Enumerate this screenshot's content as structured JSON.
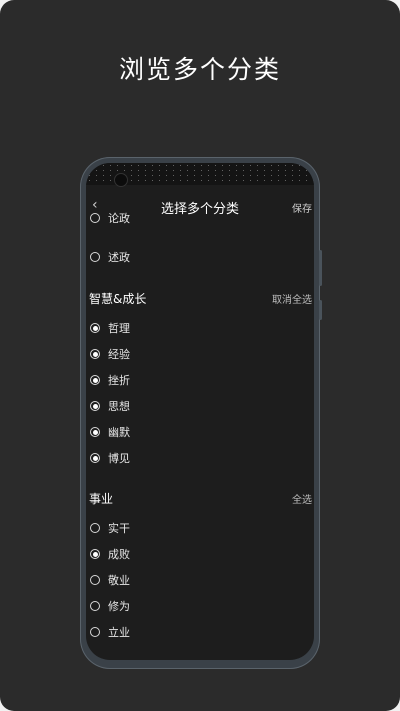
{
  "headline": "浏览多个分类",
  "app": {
    "title": "选择多个分类",
    "back_icon": "chevron-left-icon",
    "save_label": "保存"
  },
  "partial_top_item": "论政",
  "items_top": [
    {
      "label": "述政",
      "selected": false
    }
  ],
  "sections": [
    {
      "title": "智慧&成长",
      "action": "取消全选",
      "items": [
        {
          "label": "哲理",
          "selected": true
        },
        {
          "label": "经验",
          "selected": true
        },
        {
          "label": "挫折",
          "selected": true
        },
        {
          "label": "思想",
          "selected": true
        },
        {
          "label": "幽默",
          "selected": true
        },
        {
          "label": "博见",
          "selected": true
        }
      ]
    },
    {
      "title": "事业",
      "action": "全选",
      "items": [
        {
          "label": "实干",
          "selected": false
        },
        {
          "label": "成败",
          "selected": true
        },
        {
          "label": "敬业",
          "selected": false
        },
        {
          "label": "修为",
          "selected": false
        },
        {
          "label": "立业",
          "selected": false
        }
      ]
    }
  ],
  "colors": {
    "background": "#2b2b2b",
    "screen": "#1d1d1d",
    "text": "#ffffff"
  }
}
